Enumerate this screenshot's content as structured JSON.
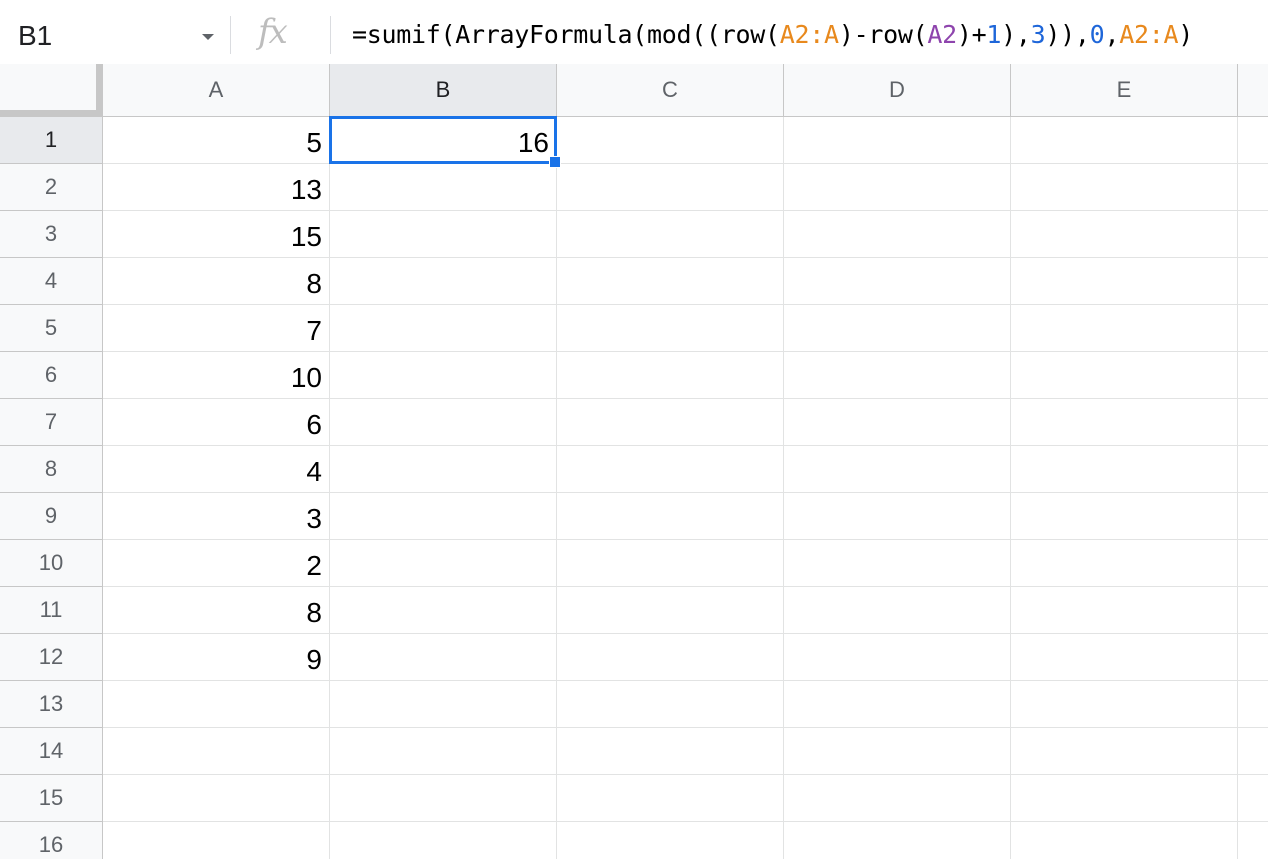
{
  "name_box": {
    "value": "B1"
  },
  "formula_bar": {
    "icon": "fx",
    "tokens": [
      {
        "text": "=sumif(ArrayFormula(mod((row(",
        "color": "default"
      },
      {
        "text": "A2:A",
        "color": "orange"
      },
      {
        "text": ")-row(",
        "color": "default"
      },
      {
        "text": "A2",
        "color": "purple"
      },
      {
        "text": ")+",
        "color": "default"
      },
      {
        "text": "1",
        "color": "blue"
      },
      {
        "text": "),",
        "color": "default"
      },
      {
        "text": "3",
        "color": "blue"
      },
      {
        "text": ")),",
        "color": "default"
      },
      {
        "text": "0",
        "color": "blue"
      },
      {
        "text": ",",
        "color": "default"
      },
      {
        "text": "A2:A",
        "color": "orange"
      },
      {
        "text": ")",
        "color": "default"
      }
    ]
  },
  "columns": [
    "A",
    "B",
    "C",
    "D",
    "E"
  ],
  "rows": [
    "1",
    "2",
    "3",
    "4",
    "5",
    "6",
    "7",
    "8",
    "9",
    "10",
    "11",
    "12",
    "13",
    "14",
    "15",
    "16"
  ],
  "selected": {
    "column": "B",
    "row": "1"
  },
  "cells": {
    "A": [
      "5",
      "13",
      "15",
      "8",
      "7",
      "10",
      "6",
      "4",
      "3",
      "2",
      "8",
      "9",
      "",
      "",
      "",
      ""
    ],
    "B": [
      "16",
      "",
      "",
      "",
      "",
      "",
      "",
      "",
      "",
      "",
      "",
      "",
      "",
      "",
      "",
      ""
    ]
  },
  "colors": {
    "selection": "#1a73e8",
    "range_ref": "#e8891d",
    "cell_ref": "#8e44ad",
    "number": "#1e66d9"
  }
}
